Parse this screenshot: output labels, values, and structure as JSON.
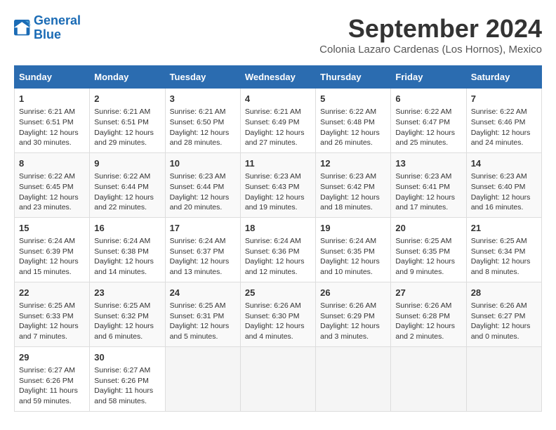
{
  "logo": {
    "line1": "General",
    "line2": "Blue"
  },
  "title": "September 2024",
  "subtitle": "Colonia Lazaro Cardenas (Los Hornos), Mexico",
  "weekdays": [
    "Sunday",
    "Monday",
    "Tuesday",
    "Wednesday",
    "Thursday",
    "Friday",
    "Saturday"
  ],
  "days": [
    {
      "date": 1,
      "sunrise": "6:21 AM",
      "sunset": "6:51 PM",
      "daylight": "Daylight: 12 hours and 30 minutes."
    },
    {
      "date": 2,
      "sunrise": "6:21 AM",
      "sunset": "6:51 PM",
      "daylight": "Daylight: 12 hours and 29 minutes."
    },
    {
      "date": 3,
      "sunrise": "6:21 AM",
      "sunset": "6:50 PM",
      "daylight": "Daylight: 12 hours and 28 minutes."
    },
    {
      "date": 4,
      "sunrise": "6:21 AM",
      "sunset": "6:49 PM",
      "daylight": "Daylight: 12 hours and 27 minutes."
    },
    {
      "date": 5,
      "sunrise": "6:22 AM",
      "sunset": "6:48 PM",
      "daylight": "Daylight: 12 hours and 26 minutes."
    },
    {
      "date": 6,
      "sunrise": "6:22 AM",
      "sunset": "6:47 PM",
      "daylight": "Daylight: 12 hours and 25 minutes."
    },
    {
      "date": 7,
      "sunrise": "6:22 AM",
      "sunset": "6:46 PM",
      "daylight": "Daylight: 12 hours and 24 minutes."
    },
    {
      "date": 8,
      "sunrise": "6:22 AM",
      "sunset": "6:45 PM",
      "daylight": "Daylight: 12 hours and 23 minutes."
    },
    {
      "date": 9,
      "sunrise": "6:22 AM",
      "sunset": "6:44 PM",
      "daylight": "Daylight: 12 hours and 22 minutes."
    },
    {
      "date": 10,
      "sunrise": "6:23 AM",
      "sunset": "6:44 PM",
      "daylight": "Daylight: 12 hours and 20 minutes."
    },
    {
      "date": 11,
      "sunrise": "6:23 AM",
      "sunset": "6:43 PM",
      "daylight": "Daylight: 12 hours and 19 minutes."
    },
    {
      "date": 12,
      "sunrise": "6:23 AM",
      "sunset": "6:42 PM",
      "daylight": "Daylight: 12 hours and 18 minutes."
    },
    {
      "date": 13,
      "sunrise": "6:23 AM",
      "sunset": "6:41 PM",
      "daylight": "Daylight: 12 hours and 17 minutes."
    },
    {
      "date": 14,
      "sunrise": "6:23 AM",
      "sunset": "6:40 PM",
      "daylight": "Daylight: 12 hours and 16 minutes."
    },
    {
      "date": 15,
      "sunrise": "6:24 AM",
      "sunset": "6:39 PM",
      "daylight": "Daylight: 12 hours and 15 minutes."
    },
    {
      "date": 16,
      "sunrise": "6:24 AM",
      "sunset": "6:38 PM",
      "daylight": "Daylight: 12 hours and 14 minutes."
    },
    {
      "date": 17,
      "sunrise": "6:24 AM",
      "sunset": "6:37 PM",
      "daylight": "Daylight: 12 hours and 13 minutes."
    },
    {
      "date": 18,
      "sunrise": "6:24 AM",
      "sunset": "6:36 PM",
      "daylight": "Daylight: 12 hours and 12 minutes."
    },
    {
      "date": 19,
      "sunrise": "6:24 AM",
      "sunset": "6:35 PM",
      "daylight": "Daylight: 12 hours and 10 minutes."
    },
    {
      "date": 20,
      "sunrise": "6:25 AM",
      "sunset": "6:35 PM",
      "daylight": "Daylight: 12 hours and 9 minutes."
    },
    {
      "date": 21,
      "sunrise": "6:25 AM",
      "sunset": "6:34 PM",
      "daylight": "Daylight: 12 hours and 8 minutes."
    },
    {
      "date": 22,
      "sunrise": "6:25 AM",
      "sunset": "6:33 PM",
      "daylight": "Daylight: 12 hours and 7 minutes."
    },
    {
      "date": 23,
      "sunrise": "6:25 AM",
      "sunset": "6:32 PM",
      "daylight": "Daylight: 12 hours and 6 minutes."
    },
    {
      "date": 24,
      "sunrise": "6:25 AM",
      "sunset": "6:31 PM",
      "daylight": "Daylight: 12 hours and 5 minutes."
    },
    {
      "date": 25,
      "sunrise": "6:26 AM",
      "sunset": "6:30 PM",
      "daylight": "Daylight: 12 hours and 4 minutes."
    },
    {
      "date": 26,
      "sunrise": "6:26 AM",
      "sunset": "6:29 PM",
      "daylight": "Daylight: 12 hours and 3 minutes."
    },
    {
      "date": 27,
      "sunrise": "6:26 AM",
      "sunset": "6:28 PM",
      "daylight": "Daylight: 12 hours and 2 minutes."
    },
    {
      "date": 28,
      "sunrise": "6:26 AM",
      "sunset": "6:27 PM",
      "daylight": "Daylight: 12 hours and 0 minutes."
    },
    {
      "date": 29,
      "sunrise": "6:27 AM",
      "sunset": "6:26 PM",
      "daylight": "Daylight: 11 hours and 59 minutes."
    },
    {
      "date": 30,
      "sunrise": "6:27 AM",
      "sunset": "6:26 PM",
      "daylight": "Daylight: 11 hours and 58 minutes."
    }
  ],
  "labels": {
    "sunrise_prefix": "Sunrise: ",
    "sunset_prefix": "Sunset: "
  }
}
